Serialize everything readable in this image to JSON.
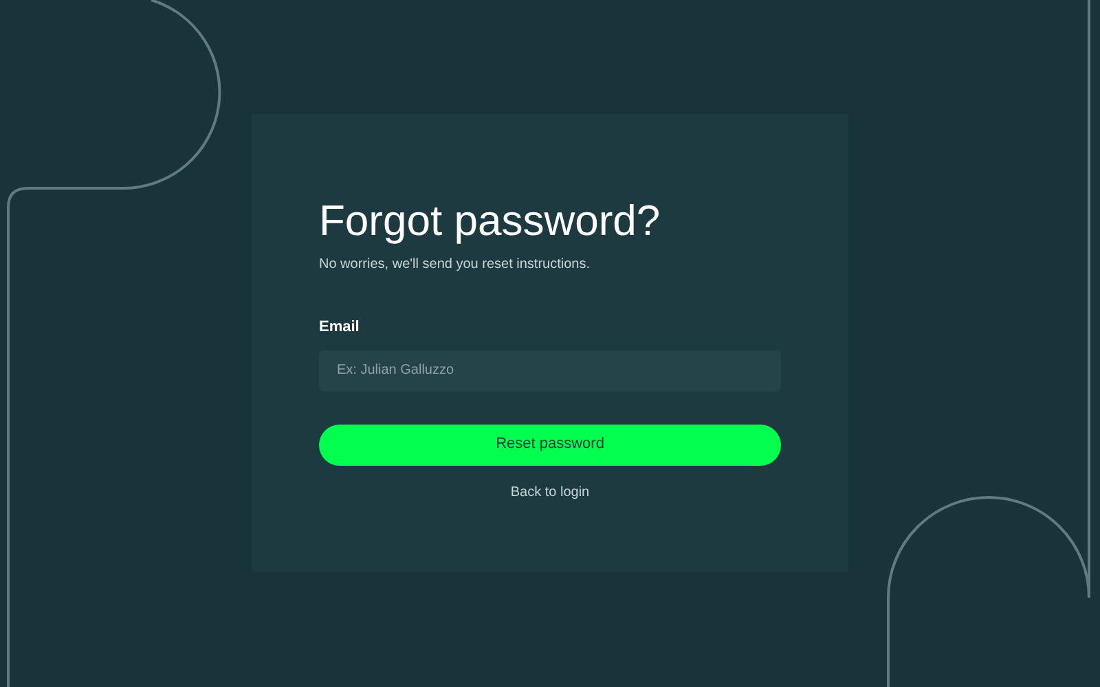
{
  "title": "Forgot password?",
  "subtitle": "No worries, we'll send you reset instructions.",
  "email": {
    "label": "Email",
    "placeholder": "Ex: Julian Galluzzo"
  },
  "submit": "Reset password",
  "back_link": "Back to login"
}
